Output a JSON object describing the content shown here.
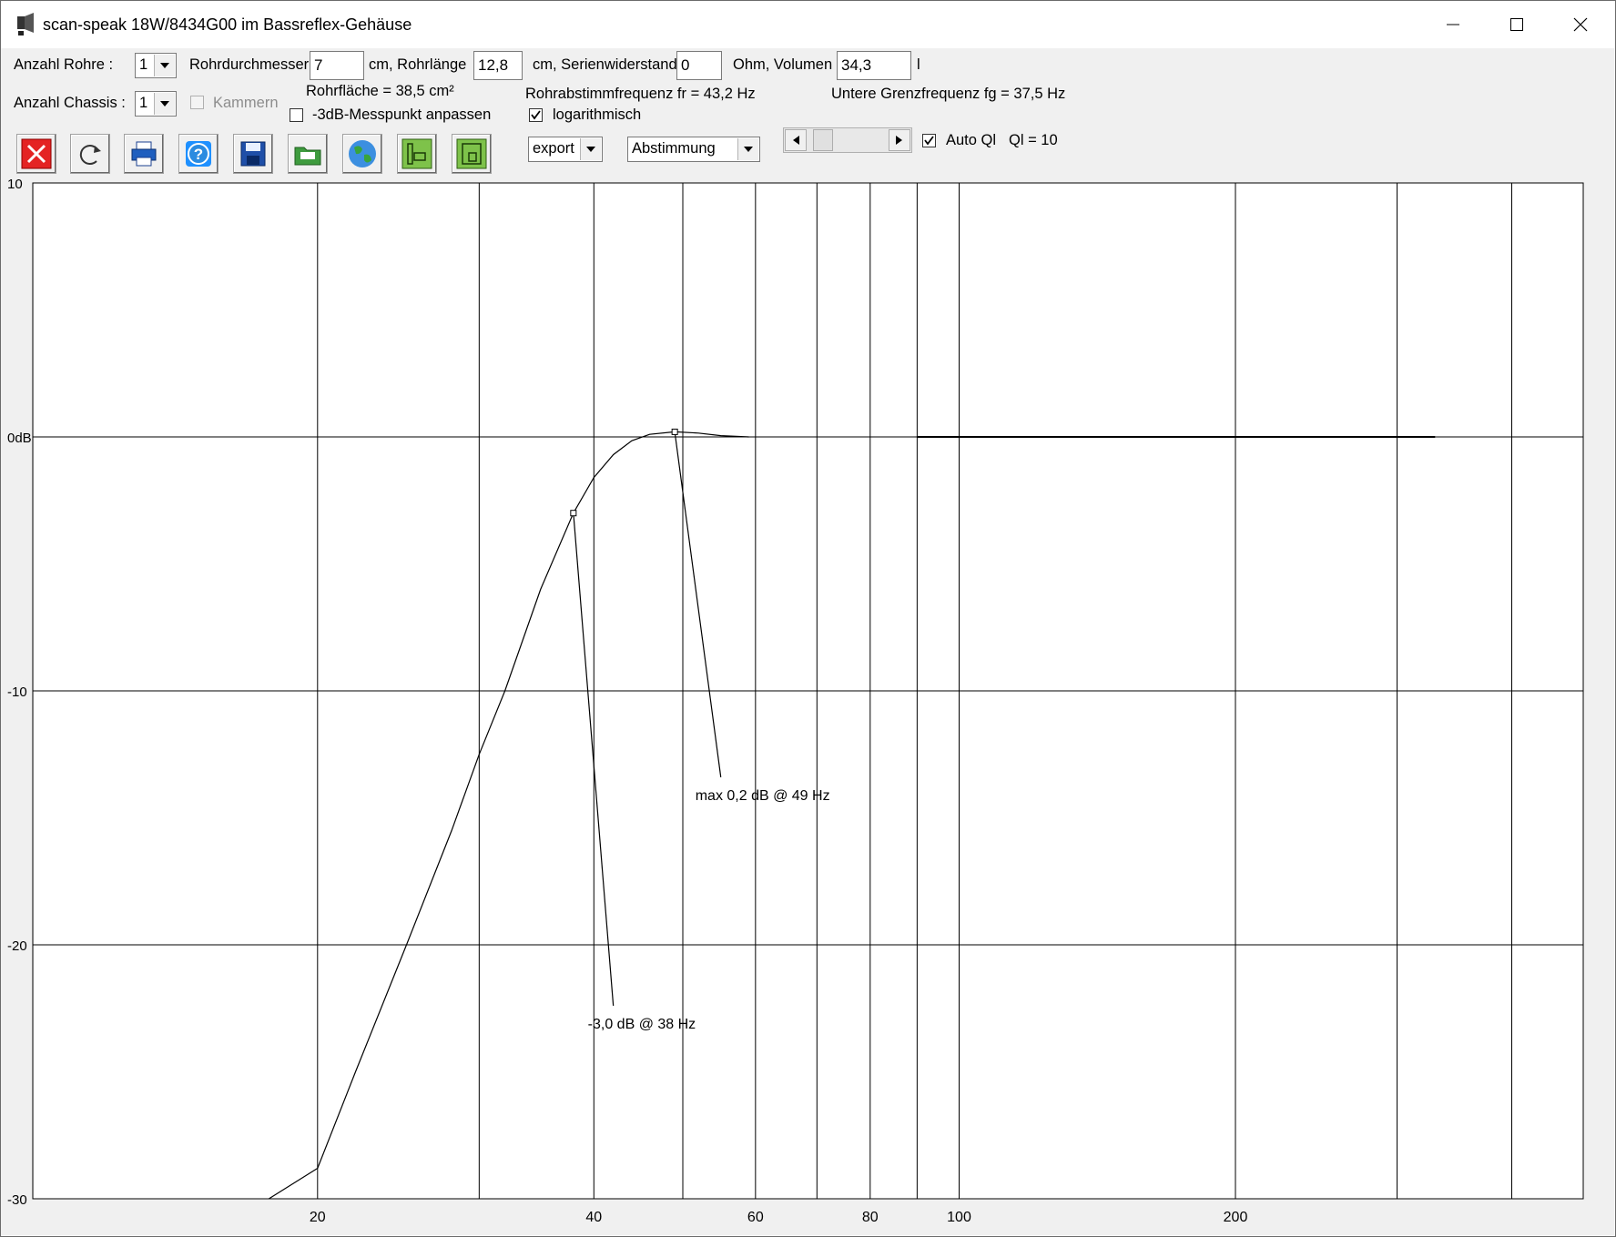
{
  "window": {
    "title": "scan-speak 18W/8434G00 im Bassreflex-Gehäuse",
    "icon": "speaker-app-icon"
  },
  "controls": {
    "anzahl_rohre_label": "Anzahl Rohre :",
    "anzahl_rohre_value": "1",
    "rohrdurchmesser_label": "Rohrdurchmesser",
    "rohrdurchmesser_value": "7",
    "rohrlaenge_label": "cm, Rohrlänge",
    "rohrlaenge_value": "12,8",
    "serienwiderstand_label": "cm, Serienwiderstand",
    "serienwiderstand_value": "0",
    "volumen_label": "Ohm, Volumen",
    "volumen_value": "34,3",
    "volumen_unit": "l",
    "anzahl_chassis_label": "Anzahl Chassis :",
    "anzahl_chassis_value": "1",
    "kammern_label": "Kammern",
    "rohrflaeche_text": "Rohrfläche = 38,5 cm²",
    "messpunkt_label": "-3dB-Messpunkt anpassen",
    "rohrabstimm_text": "Rohrabstimmfrequenz fr = 43,2 Hz",
    "logarithmisch_label": "logarithmisch",
    "grenzfrequenz_text": "Untere Grenzfrequenz fg = 37,5 Hz",
    "export_value": "export",
    "abstimmung_value": "Abstimmung",
    "auto_ql_label": "Auto Ql",
    "ql_text": "Ql = 10"
  },
  "toolbar": {
    "icons": [
      "close-red-icon",
      "refresh-icon",
      "print-icon",
      "help-icon",
      "save-icon",
      "open-folder-icon",
      "globe-icon",
      "chassis-left-icon",
      "chassis-right-icon"
    ]
  },
  "chart_data": {
    "type": "line",
    "title": "",
    "xlabel": "",
    "ylabel": "",
    "x_scale": "log",
    "x_ticks": [
      "20",
      "40",
      "60",
      "80",
      "100",
      "200"
    ],
    "y_ticks": [
      "10",
      "0dB",
      "-10",
      "-20",
      "-30"
    ],
    "ylim": [
      -30,
      10
    ],
    "series": [
      {
        "points": [
          [
            17.7,
            -31
          ],
          [
            20,
            -28.8
          ],
          [
            22,
            -25
          ],
          [
            25,
            -20
          ],
          [
            28,
            -15.5
          ],
          [
            30,
            -12.5
          ],
          [
            32,
            -10
          ],
          [
            35,
            -6
          ],
          [
            38,
            -3.0
          ],
          [
            40,
            -1.6
          ],
          [
            42,
            -0.7
          ],
          [
            44,
            -0.15
          ],
          [
            46,
            0.1
          ],
          [
            49,
            0.2
          ],
          [
            52,
            0.15
          ],
          [
            55,
            0.05
          ],
          [
            59,
            0.0
          ]
        ]
      },
      {
        "points": [
          [
            90,
            0.0
          ],
          [
            330,
            0.0
          ]
        ]
      }
    ],
    "annotations": [
      {
        "text": "max 0,2 dB @ 49 Hz",
        "x": 49,
        "y": 0.2,
        "label_x": 55,
        "label_y": -13.4
      },
      {
        "text": "-3,0 dB @  38 Hz",
        "x": 38,
        "y": -3.0,
        "label_x": 42,
        "label_y": -22.4
      }
    ],
    "grid_v_values": [
      20,
      30,
      40,
      50,
      60,
      70,
      80,
      90,
      100,
      200,
      300,
      400
    ]
  }
}
